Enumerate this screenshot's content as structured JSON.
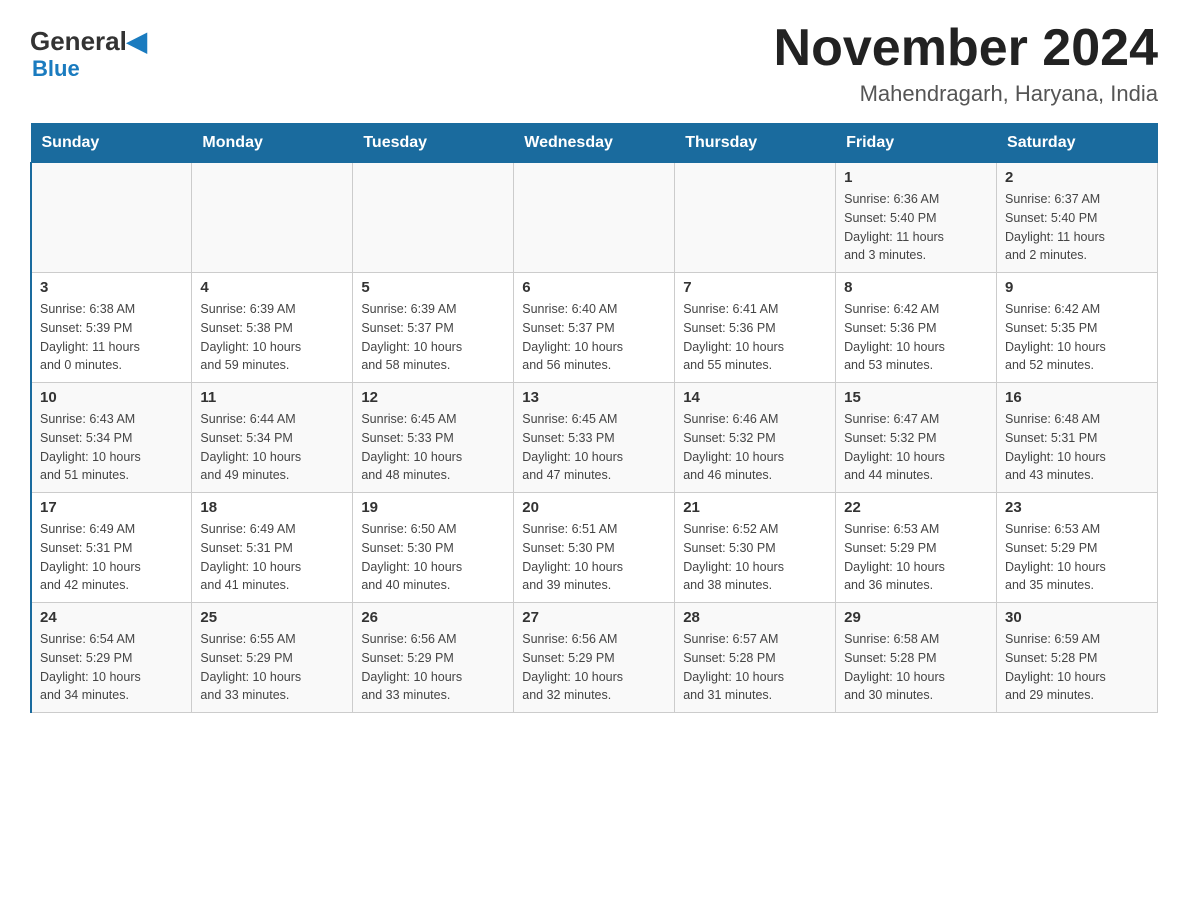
{
  "header": {
    "logo_general": "General",
    "logo_blue": "Blue",
    "title": "November 2024",
    "subtitle": "Mahendragarh, Haryana, India"
  },
  "days_of_week": [
    "Sunday",
    "Monday",
    "Tuesday",
    "Wednesday",
    "Thursday",
    "Friday",
    "Saturday"
  ],
  "weeks": [
    [
      {
        "day": "",
        "info": ""
      },
      {
        "day": "",
        "info": ""
      },
      {
        "day": "",
        "info": ""
      },
      {
        "day": "",
        "info": ""
      },
      {
        "day": "",
        "info": ""
      },
      {
        "day": "1",
        "info": "Sunrise: 6:36 AM\nSunset: 5:40 PM\nDaylight: 11 hours\nand 3 minutes."
      },
      {
        "day": "2",
        "info": "Sunrise: 6:37 AM\nSunset: 5:40 PM\nDaylight: 11 hours\nand 2 minutes."
      }
    ],
    [
      {
        "day": "3",
        "info": "Sunrise: 6:38 AM\nSunset: 5:39 PM\nDaylight: 11 hours\nand 0 minutes."
      },
      {
        "day": "4",
        "info": "Sunrise: 6:39 AM\nSunset: 5:38 PM\nDaylight: 10 hours\nand 59 minutes."
      },
      {
        "day": "5",
        "info": "Sunrise: 6:39 AM\nSunset: 5:37 PM\nDaylight: 10 hours\nand 58 minutes."
      },
      {
        "day": "6",
        "info": "Sunrise: 6:40 AM\nSunset: 5:37 PM\nDaylight: 10 hours\nand 56 minutes."
      },
      {
        "day": "7",
        "info": "Sunrise: 6:41 AM\nSunset: 5:36 PM\nDaylight: 10 hours\nand 55 minutes."
      },
      {
        "day": "8",
        "info": "Sunrise: 6:42 AM\nSunset: 5:36 PM\nDaylight: 10 hours\nand 53 minutes."
      },
      {
        "day": "9",
        "info": "Sunrise: 6:42 AM\nSunset: 5:35 PM\nDaylight: 10 hours\nand 52 minutes."
      }
    ],
    [
      {
        "day": "10",
        "info": "Sunrise: 6:43 AM\nSunset: 5:34 PM\nDaylight: 10 hours\nand 51 minutes."
      },
      {
        "day": "11",
        "info": "Sunrise: 6:44 AM\nSunset: 5:34 PM\nDaylight: 10 hours\nand 49 minutes."
      },
      {
        "day": "12",
        "info": "Sunrise: 6:45 AM\nSunset: 5:33 PM\nDaylight: 10 hours\nand 48 minutes."
      },
      {
        "day": "13",
        "info": "Sunrise: 6:45 AM\nSunset: 5:33 PM\nDaylight: 10 hours\nand 47 minutes."
      },
      {
        "day": "14",
        "info": "Sunrise: 6:46 AM\nSunset: 5:32 PM\nDaylight: 10 hours\nand 46 minutes."
      },
      {
        "day": "15",
        "info": "Sunrise: 6:47 AM\nSunset: 5:32 PM\nDaylight: 10 hours\nand 44 minutes."
      },
      {
        "day": "16",
        "info": "Sunrise: 6:48 AM\nSunset: 5:31 PM\nDaylight: 10 hours\nand 43 minutes."
      }
    ],
    [
      {
        "day": "17",
        "info": "Sunrise: 6:49 AM\nSunset: 5:31 PM\nDaylight: 10 hours\nand 42 minutes."
      },
      {
        "day": "18",
        "info": "Sunrise: 6:49 AM\nSunset: 5:31 PM\nDaylight: 10 hours\nand 41 minutes."
      },
      {
        "day": "19",
        "info": "Sunrise: 6:50 AM\nSunset: 5:30 PM\nDaylight: 10 hours\nand 40 minutes."
      },
      {
        "day": "20",
        "info": "Sunrise: 6:51 AM\nSunset: 5:30 PM\nDaylight: 10 hours\nand 39 minutes."
      },
      {
        "day": "21",
        "info": "Sunrise: 6:52 AM\nSunset: 5:30 PM\nDaylight: 10 hours\nand 38 minutes."
      },
      {
        "day": "22",
        "info": "Sunrise: 6:53 AM\nSunset: 5:29 PM\nDaylight: 10 hours\nand 36 minutes."
      },
      {
        "day": "23",
        "info": "Sunrise: 6:53 AM\nSunset: 5:29 PM\nDaylight: 10 hours\nand 35 minutes."
      }
    ],
    [
      {
        "day": "24",
        "info": "Sunrise: 6:54 AM\nSunset: 5:29 PM\nDaylight: 10 hours\nand 34 minutes."
      },
      {
        "day": "25",
        "info": "Sunrise: 6:55 AM\nSunset: 5:29 PM\nDaylight: 10 hours\nand 33 minutes."
      },
      {
        "day": "26",
        "info": "Sunrise: 6:56 AM\nSunset: 5:29 PM\nDaylight: 10 hours\nand 33 minutes."
      },
      {
        "day": "27",
        "info": "Sunrise: 6:56 AM\nSunset: 5:29 PM\nDaylight: 10 hours\nand 32 minutes."
      },
      {
        "day": "28",
        "info": "Sunrise: 6:57 AM\nSunset: 5:28 PM\nDaylight: 10 hours\nand 31 minutes."
      },
      {
        "day": "29",
        "info": "Sunrise: 6:58 AM\nSunset: 5:28 PM\nDaylight: 10 hours\nand 30 minutes."
      },
      {
        "day": "30",
        "info": "Sunrise: 6:59 AM\nSunset: 5:28 PM\nDaylight: 10 hours\nand 29 minutes."
      }
    ]
  ]
}
